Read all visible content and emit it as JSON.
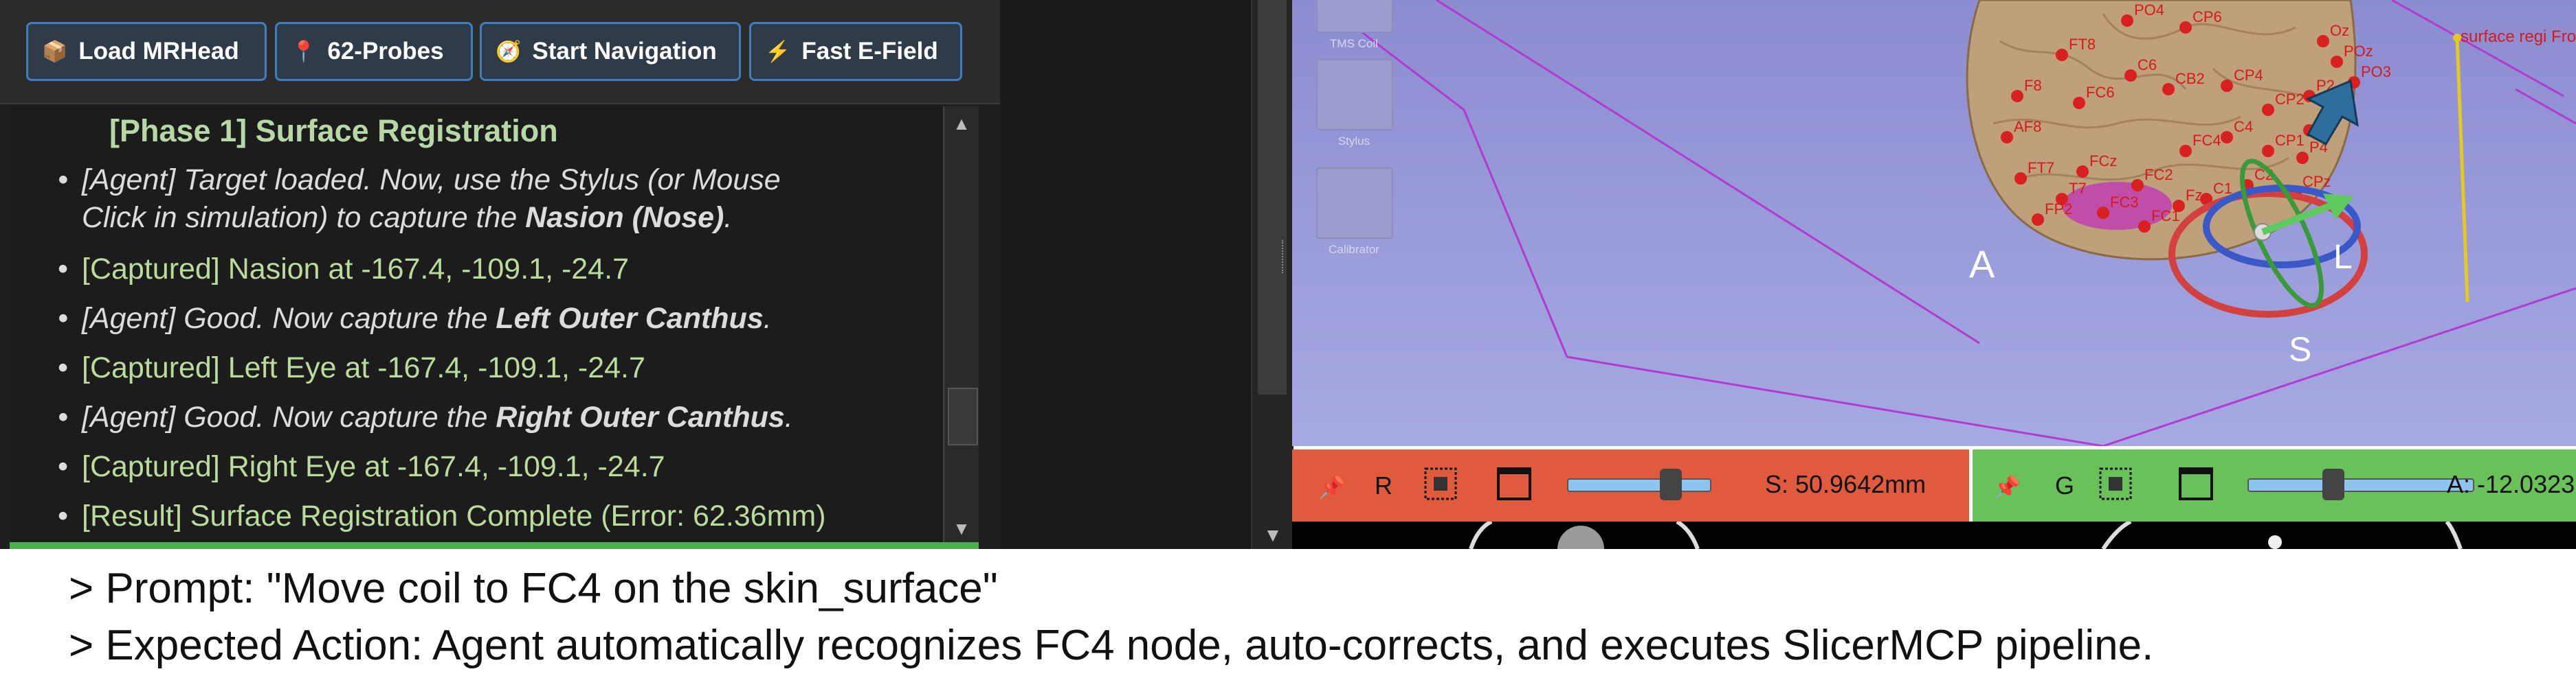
{
  "toolbar": {
    "buttons": [
      {
        "label": "Load MRHead",
        "icon": "package-icon",
        "glyph": "📦"
      },
      {
        "label": "62-Probes",
        "icon": "pushpin-icon",
        "glyph": "📍"
      },
      {
        "label": "Start Navigation",
        "icon": "compass-icon",
        "glyph": "🧭"
      },
      {
        "label": "Fast E-Field",
        "icon": "lightning-icon",
        "glyph": "⚡"
      }
    ]
  },
  "log": {
    "title": "[Phase 1] Surface Registration",
    "lines": {
      "l1a": "[Agent] Target loaded. Now, use the Stylus (or Mouse",
      "l1b": "Click in simulation) to capture the ",
      "l1b_bold": "Nasion (Nose)",
      "l1b_end": ".",
      "l2": "[Captured] Nasion at -167.4, -109.1, -24.7",
      "l3a": "[Agent] Good. Now capture the ",
      "l3_bold": "Left Outer Canthus",
      "l3_end": ".",
      "l4": "[Captured] Left Eye at -167.4, -109.1, -24.7",
      "l5a": "[Agent] Good. Now capture the ",
      "l5_bold": "Right Outer Canthus",
      "l5_end": ".",
      "l6": "[Captured] Right Eye at -167.4, -109.1, -24.7",
      "l7": "[Result] Surface Registration Complete (Error: 62.36mm)"
    }
  },
  "view3d": {
    "tools": [
      {
        "label": "TMS Coil"
      },
      {
        "label": "Stylus"
      },
      {
        "label": "Calibrator"
      }
    ],
    "orientation_A": "A",
    "orientation_L": "L",
    "orientation_S": "S",
    "surface_label": "surface regi From",
    "electrodes": [
      "PO4",
      "CP6",
      "FT8",
      "F8",
      "FC6",
      "C6",
      "CB2",
      "CP4",
      "CP2",
      "P2",
      "FT7",
      "FC4",
      "C4",
      "CP1",
      "FCz",
      "FC2",
      "Fz",
      "FC3",
      "FC1",
      "C1",
      "C2",
      "AF8",
      "FP2",
      "T7",
      "P4",
      "CPz",
      "Oz",
      "POz",
      "PO3",
      "P1"
    ],
    "colors": {
      "brain": "#bfa07a",
      "electrode": "#d82020",
      "label": "#d41a1a"
    }
  },
  "slices": {
    "red": {
      "letter": "R",
      "value": "S: 50.9642mm",
      "slider_fraction": 0.72
    },
    "green": {
      "letter": "G",
      "value": "A: -12.0323",
      "slider_fraction": 0.38
    }
  },
  "caption": {
    "line1": "> Prompt: \"Move coil to FC4 on the skin_surface\"",
    "line2": "> Expected Action: Agent automatically recognizes FC4 node, auto-corrects, and executes SlicerMCP pipeline."
  }
}
